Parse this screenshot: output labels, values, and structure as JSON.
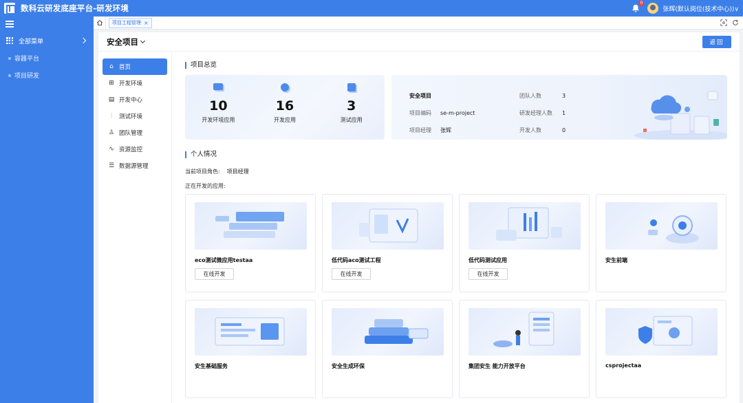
{
  "header": {
    "title": "数科云研发底座平台-研发环境",
    "notification_count": "0",
    "user": "张辉(默认岗位(技术中心))∨"
  },
  "sidebar": {
    "all_menu": "全部菜单",
    "items": [
      {
        "label": "容器平台"
      },
      {
        "label": "项目研发"
      }
    ]
  },
  "tabs": {
    "items": [
      {
        "label": "项目工程管理"
      }
    ],
    "close_glyph": "×"
  },
  "main": {
    "project_name": "安全项目",
    "back_label": "返回"
  },
  "subnav": {
    "items": [
      {
        "label": "首页",
        "icon": "home-icon",
        "glyph": "⌂"
      },
      {
        "label": "开发环境",
        "icon": "apps-icon",
        "glyph": "⊞"
      },
      {
        "label": "开发中心",
        "icon": "calendar-icon",
        "glyph": "▤"
      },
      {
        "label": "测试环境",
        "icon": "sliders-icon",
        "glyph": "⫶"
      },
      {
        "label": "团队管理",
        "icon": "user-icon",
        "glyph": "♙"
      },
      {
        "label": "资源监控",
        "icon": "pulse-icon",
        "glyph": "∿"
      },
      {
        "label": "数据源管理",
        "icon": "database-icon",
        "glyph": "☰"
      }
    ]
  },
  "overview": {
    "title": "项目总览",
    "stats": [
      {
        "value": "10",
        "label": "开发环境应用"
      },
      {
        "value": "16",
        "label": "开发应用"
      },
      {
        "value": "3",
        "label": "测试应用"
      }
    ],
    "project_name": "安全项目",
    "code_label": "项目编码",
    "code_value": "se-m-project",
    "manager_label": "项目经理",
    "manager_value": "张辉",
    "team_label": "团队人数",
    "team_value": "3",
    "rd_manager_label": "研发经理人数",
    "rd_manager_value": "1",
    "dev_label": "开发人数",
    "dev_value": "0"
  },
  "personal": {
    "title": "个人情况",
    "role_label": "当前项目角色:",
    "role_value": "项目经理",
    "developing_label": "正在开发的应用:"
  },
  "apps": [
    {
      "name": "eco测试微应用testaa",
      "button": "在线开发"
    },
    {
      "name": "低代码aco测试工程",
      "button": "在线开发"
    },
    {
      "name": "低代码测试应用",
      "button": "在线开发"
    },
    {
      "name": "安生前端",
      "button": ""
    },
    {
      "name": "安生基础服务",
      "button": ""
    },
    {
      "name": "安全生成环保",
      "button": ""
    },
    {
      "name": "集团安生 能力开放平台",
      "button": ""
    },
    {
      "name": "csprojectaa",
      "button": ""
    }
  ],
  "colors": {
    "primary": "#3d7fe8",
    "badge": "#f04141"
  }
}
